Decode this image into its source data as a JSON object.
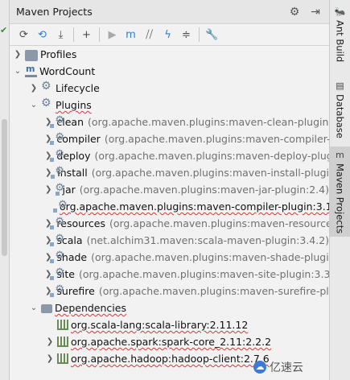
{
  "panel": {
    "title": "Maven Projects"
  },
  "tree": {
    "profiles": "Profiles",
    "project": "WordCount",
    "lifecycle": "Lifecycle",
    "plugins_label": "Plugins",
    "plugins": [
      {
        "name": "clean",
        "detail": "(org.apache.maven.plugins:maven-clean-plugin:2"
      },
      {
        "name": "compiler",
        "detail": "(org.apache.maven.plugins:maven-compiler-p"
      },
      {
        "name": "deploy",
        "detail": "(org.apache.maven.plugins:maven-deploy-plug"
      },
      {
        "name": "install",
        "detail": "(org.apache.maven.plugins:maven-install-plugi"
      },
      {
        "name": "jar",
        "detail": "(org.apache.maven.plugins:maven-jar-plugin:2.4)"
      },
      {
        "name": "org.apache.maven.plugins:maven-compiler-plugin:3.1",
        "detail": ""
      },
      {
        "name": "resources",
        "detail": "(org.apache.maven.plugins:maven-resource"
      },
      {
        "name": "scala",
        "detail": "(net.alchim31.maven:scala-maven-plugin:3.4.2)"
      },
      {
        "name": "shade",
        "detail": "(org.apache.maven.plugins:maven-shade-plugin"
      },
      {
        "name": "site",
        "detail": "(org.apache.maven.plugins:maven-site-plugin:3.3)"
      },
      {
        "name": "surefire",
        "detail": "(org.apache.maven.plugins:maven-surefire-plu"
      }
    ],
    "dependencies_label": "Dependencies",
    "dependencies": [
      "org.scala-lang:scala-library:2.11.12",
      "org.apache.spark:spark-core_2.11:2.2.2",
      "org.apache.hadoop:hadoop-client:2.7.6"
    ]
  },
  "side_tabs": {
    "ant": "Ant Build",
    "database": "Database",
    "maven": "Maven Projects"
  },
  "watermark": "亿速云"
}
